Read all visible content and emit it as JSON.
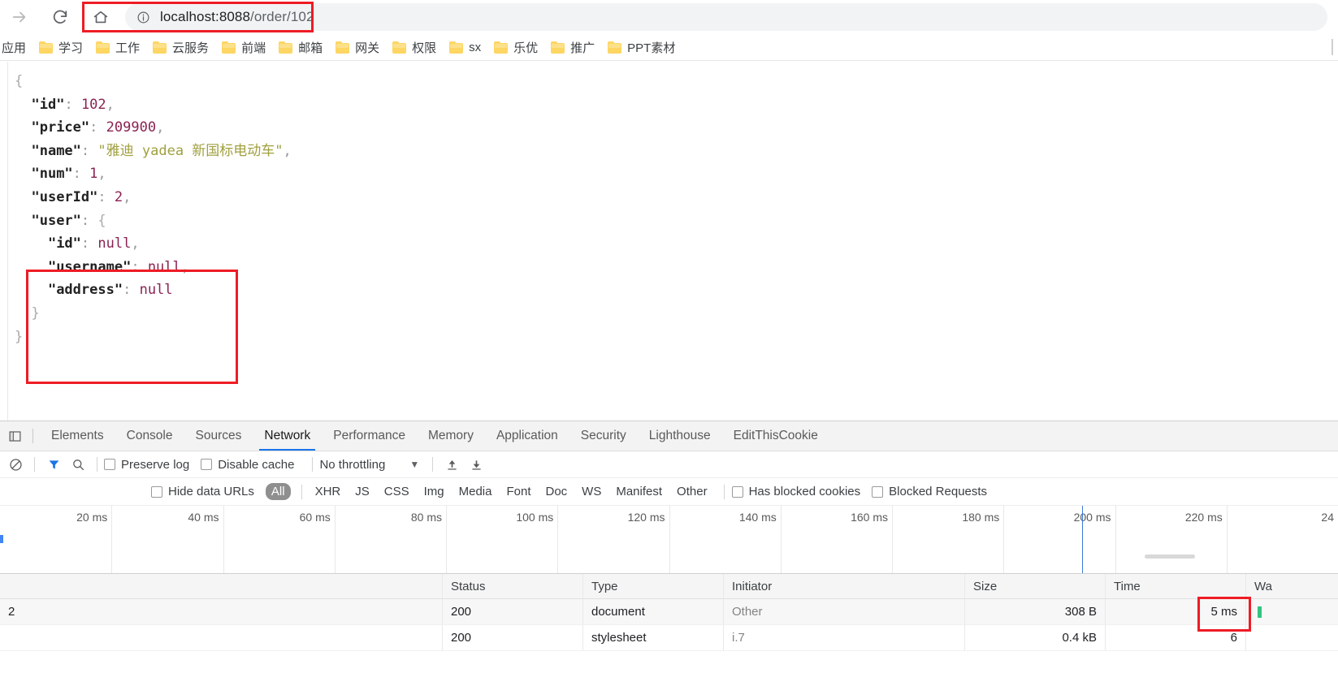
{
  "browser": {
    "nav": {
      "forward_icon": "arrow-forward-icon",
      "reload_icon": "reload-icon",
      "home_icon": "home-icon"
    },
    "omnibox": {
      "info_icon": "page-info-icon",
      "url_host": "localhost:8088",
      "url_path": "/order/102",
      "url_full": "localhost:8088/order/102"
    },
    "bookmarks": [
      {
        "label": "应用",
        "has_folder": false
      },
      {
        "label": "学习",
        "has_folder": true
      },
      {
        "label": "工作",
        "has_folder": true
      },
      {
        "label": "云服务",
        "has_folder": true
      },
      {
        "label": "前端",
        "has_folder": true
      },
      {
        "label": "邮箱",
        "has_folder": true
      },
      {
        "label": "网关",
        "has_folder": true
      },
      {
        "label": "权限",
        "has_folder": true
      },
      {
        "label": "sx",
        "has_folder": true
      },
      {
        "label": "乐优",
        "has_folder": true
      },
      {
        "label": "推广",
        "has_folder": true
      },
      {
        "label": "PPT素材",
        "has_folder": true
      }
    ]
  },
  "page_content": {
    "json_lines": [
      {
        "indent": 0,
        "parts": [
          {
            "t": "brace",
            "v": "{"
          }
        ]
      },
      {
        "indent": 1,
        "parts": [
          {
            "t": "key",
            "v": "\"id\""
          },
          {
            "t": "punct",
            "v": ":"
          },
          {
            "t": "space",
            "v": " "
          },
          {
            "t": "num",
            "v": "102"
          },
          {
            "t": "punct",
            "v": ","
          }
        ]
      },
      {
        "indent": 1,
        "parts": [
          {
            "t": "key",
            "v": "\"price\""
          },
          {
            "t": "punct",
            "v": ":"
          },
          {
            "t": "space",
            "v": " "
          },
          {
            "t": "num",
            "v": "209900"
          },
          {
            "t": "punct",
            "v": ","
          }
        ]
      },
      {
        "indent": 1,
        "parts": [
          {
            "t": "key",
            "v": "\"name\""
          },
          {
            "t": "punct",
            "v": ":"
          },
          {
            "t": "space",
            "v": " "
          },
          {
            "t": "str",
            "v": "\"雅迪 yadea 新国标电动车\""
          },
          {
            "t": "punct",
            "v": ","
          }
        ]
      },
      {
        "indent": 1,
        "parts": [
          {
            "t": "key",
            "v": "\"num\""
          },
          {
            "t": "punct",
            "v": ":"
          },
          {
            "t": "space",
            "v": " "
          },
          {
            "t": "num",
            "v": "1"
          },
          {
            "t": "punct",
            "v": ","
          }
        ]
      },
      {
        "indent": 1,
        "parts": [
          {
            "t": "key",
            "v": "\"userId\""
          },
          {
            "t": "punct",
            "v": ":"
          },
          {
            "t": "space",
            "v": " "
          },
          {
            "t": "num",
            "v": "2"
          },
          {
            "t": "punct",
            "v": ","
          }
        ]
      },
      {
        "indent": 1,
        "parts": [
          {
            "t": "key",
            "v": "\"user\""
          },
          {
            "t": "punct",
            "v": ":"
          },
          {
            "t": "space",
            "v": " "
          },
          {
            "t": "brace",
            "v": "{"
          }
        ]
      },
      {
        "indent": 2,
        "parts": [
          {
            "t": "key",
            "v": "\"id\""
          },
          {
            "t": "punct",
            "v": ":"
          },
          {
            "t": "space",
            "v": " "
          },
          {
            "t": "null",
            "v": "null"
          },
          {
            "t": "punct",
            "v": ","
          }
        ]
      },
      {
        "indent": 2,
        "parts": [
          {
            "t": "key",
            "v": "\"username\""
          },
          {
            "t": "punct",
            "v": ":"
          },
          {
            "t": "space",
            "v": " "
          },
          {
            "t": "null",
            "v": "null"
          },
          {
            "t": "punct",
            "v": ","
          }
        ]
      },
      {
        "indent": 2,
        "parts": [
          {
            "t": "key",
            "v": "\"address\""
          },
          {
            "t": "punct",
            "v": ":"
          },
          {
            "t": "space",
            "v": " "
          },
          {
            "t": "null",
            "v": "null"
          }
        ]
      },
      {
        "indent": 1,
        "parts": [
          {
            "t": "brace",
            "v": "}"
          }
        ]
      },
      {
        "indent": 0,
        "parts": [
          {
            "t": "brace",
            "v": "}"
          }
        ]
      }
    ],
    "response_object": {
      "id": 102,
      "price": 209900,
      "name": "雅迪 yadea 新国标电动车",
      "num": 1,
      "userId": 2,
      "user": {
        "id": null,
        "username": null,
        "address": null
      }
    }
  },
  "devtools": {
    "dock_icon": "dock-panel-icon",
    "tabs": [
      {
        "label": "Elements",
        "active": false
      },
      {
        "label": "Console",
        "active": false
      },
      {
        "label": "Sources",
        "active": false
      },
      {
        "label": "Network",
        "active": true
      },
      {
        "label": "Performance",
        "active": false
      },
      {
        "label": "Memory",
        "active": false
      },
      {
        "label": "Application",
        "active": false
      },
      {
        "label": "Security",
        "active": false
      },
      {
        "label": "Lighthouse",
        "active": false
      },
      {
        "label": "EditThisCookie",
        "active": false
      }
    ],
    "toolbar": {
      "clear_icon": "clear-network-log-icon",
      "filter_icon": "filter-icon",
      "search_icon": "search-icon",
      "preserve_log_label": "Preserve log",
      "preserve_log_checked": false,
      "disable_cache_label": "Disable cache",
      "disable_cache_checked": false,
      "throttling_value": "No throttling",
      "throttling_caret": "chevron-down-icon",
      "import_icon": "import-har-icon",
      "export_icon": "export-har-icon",
      "filter_active_color": "#1a73e8"
    },
    "filters": {
      "hide_data_urls_label": "Hide data URLs",
      "hide_data_urls_checked": false,
      "types": [
        "All",
        "XHR",
        "JS",
        "CSS",
        "Img",
        "Media",
        "Font",
        "Doc",
        "WS",
        "Manifest",
        "Other"
      ],
      "selected_type": "All",
      "has_blocked_cookies_label": "Has blocked cookies",
      "has_blocked_cookies_checked": false,
      "blocked_requests_label": "Blocked Requests",
      "blocked_requests_checked": false
    },
    "overview": {
      "ticks": [
        "20 ms",
        "40 ms",
        "60 ms",
        "80 ms",
        "100 ms",
        "120 ms",
        "140 ms",
        "160 ms",
        "180 ms",
        "200 ms",
        "220 ms",
        "24"
      ]
    },
    "requests": {
      "columns": [
        "",
        "Status",
        "Type",
        "Initiator",
        "Size",
        "Time",
        "Wa"
      ],
      "rows": [
        {
          "name": "2",
          "status": "200",
          "type": "document",
          "initiator": "Other",
          "size": "308 B",
          "time": "5 ms"
        },
        {
          "name": "",
          "status": "200",
          "type": "stylesheet",
          "initiator": "i.7",
          "size": "0.4 kB",
          "time": "6"
        }
      ]
    }
  },
  "annotations": {
    "highlight_color": "#ee1c25",
    "boxes": [
      "url-bar-highlight",
      "user-object-highlight",
      "time-value-highlight"
    ]
  }
}
